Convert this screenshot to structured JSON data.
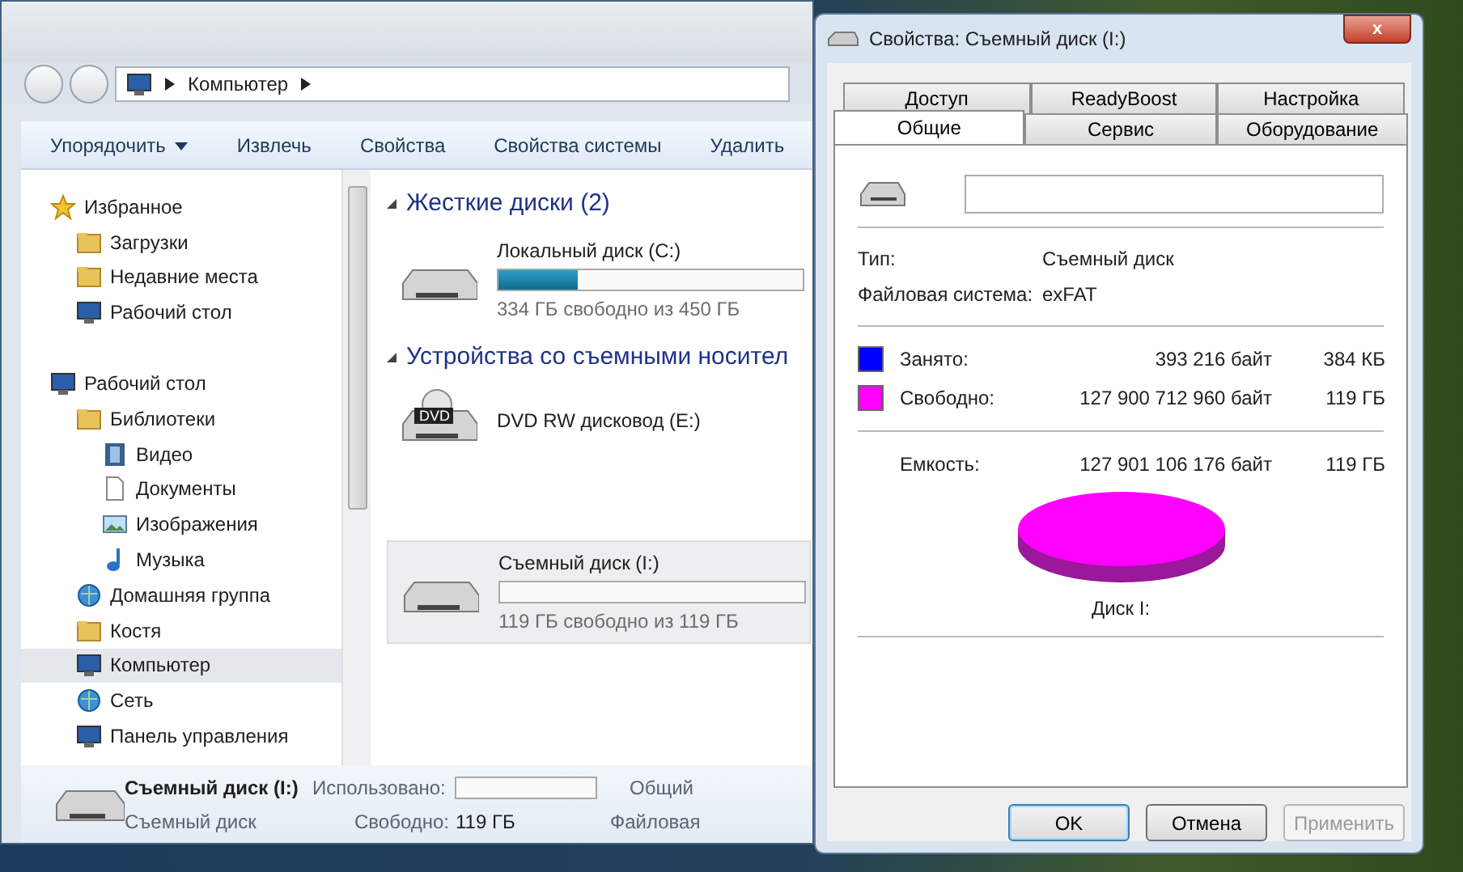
{
  "explorer": {
    "breadcrumb": [
      "Компьютер"
    ],
    "toolbar": [
      {
        "label": "Упорядочить",
        "dropdown": true
      },
      {
        "label": "Извлечь",
        "dropdown": false
      },
      {
        "label": "Свойства",
        "dropdown": false
      },
      {
        "label": "Свойства системы",
        "dropdown": false
      },
      {
        "label": "Удалить",
        "dropdown": false
      }
    ],
    "sidebar": [
      {
        "label": "Избранное",
        "kind": "star",
        "selected": false,
        "children": [
          {
            "label": "Загрузки",
            "kind": "folder",
            "selected": false
          },
          {
            "label": "Недавние места",
            "kind": "folder",
            "selected": false
          },
          {
            "label": "Рабочий стол",
            "kind": "monitor",
            "selected": false
          }
        ]
      },
      {
        "label": "Рабочий стол",
        "kind": "monitor",
        "selected": false,
        "children": [
          {
            "label": "Библиотеки",
            "kind": "folder",
            "selected": false,
            "children": [
              {
                "label": "Видео",
                "kind": "film",
                "selected": false
              },
              {
                "label": "Документы",
                "kind": "document",
                "selected": false
              },
              {
                "label": "Изображения",
                "kind": "picture",
                "selected": false
              },
              {
                "label": "Музыка",
                "kind": "note",
                "selected": false
              }
            ]
          },
          {
            "label": "Домашняя группа",
            "kind": "network",
            "selected": false
          },
          {
            "label": "Костя",
            "kind": "folder",
            "selected": false
          },
          {
            "label": "Компьютер",
            "kind": "monitor",
            "selected": true
          },
          {
            "label": "Сеть",
            "kind": "network",
            "selected": false
          },
          {
            "label": "Панель управления",
            "kind": "monitor",
            "selected": false
          }
        ]
      }
    ],
    "sections": [
      {
        "title": "Жесткие диски (2)",
        "drives": [
          {
            "kind": "disk",
            "name": "Локальный диск (C:)",
            "level": 0.26,
            "free": "334 ГБ свободно из 450 ГБ",
            "selected": false
          }
        ]
      },
      {
        "title": "Устройства со съемными носител",
        "drives": [
          {
            "kind": "optical",
            "name": "DVD RW дисковод (E:)",
            "badge": "DVD",
            "selected": false
          },
          {
            "kind": "disk",
            "name": "Съемный диск (I:)",
            "level": 0.0,
            "free": "119 ГБ свободно из 119 ГБ",
            "selected": true
          }
        ]
      }
    ],
    "details": {
      "name": "Съемный диск (I:)",
      "type": "Съемный диск",
      "used_label": "Использовано:",
      "used_bar": {
        "level": 0.0
      },
      "free_label": "Свободно:",
      "free_value": "119 ГБ",
      "total_label": "Общий",
      "fs_label": "Файловая"
    }
  },
  "dialog": {
    "title": "Свойства: Съемный диск (I:)",
    "close": "x",
    "tab_rows": [
      [
        {
          "label": "Доступ",
          "selected": false
        },
        {
          "label": "ReadyBoost",
          "selected": false
        },
        {
          "label": "Настройка",
          "selected": false
        }
      ],
      [
        {
          "label": "Общие",
          "selected": true
        },
        {
          "label": "Сервис",
          "selected": false
        },
        {
          "label": "Оборудование",
          "selected": false
        }
      ]
    ],
    "info": [
      {
        "label": "Тип:",
        "value": "Съемный диск"
      },
      {
        "label": "Файловая система:",
        "value": "exFAT"
      }
    ],
    "usage": [
      {
        "label": "Занято:",
        "bytes": "393 216 байт",
        "size": "384 КБ",
        "color": "#0000ff"
      },
      {
        "label": "Свободно:",
        "bytes": "127 900 712 960 байт",
        "size": "119 ГБ",
        "color": "#ff00ff"
      }
    ],
    "capacity": {
      "label": "Емкость:",
      "bytes": "127 901 106 176 байт",
      "size": "119 ГБ"
    },
    "pie_caption": "Диск I:",
    "buttons": [
      {
        "label": "OK",
        "default": true,
        "disabled": false
      },
      {
        "label": "Отмена",
        "default": false,
        "disabled": false
      },
      {
        "label": "Применить",
        "default": false,
        "disabled": true
      }
    ]
  }
}
